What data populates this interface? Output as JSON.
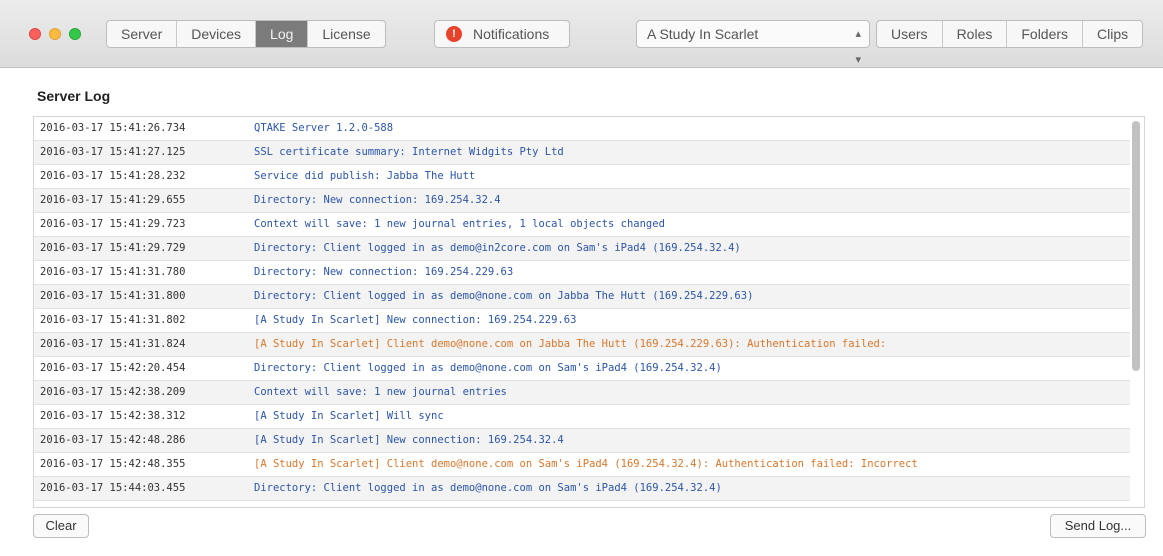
{
  "tabs": [
    {
      "label": "Server"
    },
    {
      "label": "Devices"
    },
    {
      "label": "Log",
      "active": true
    },
    {
      "label": "License"
    }
  ],
  "notifications": {
    "label": "Notifications",
    "count": "!"
  },
  "project": {
    "selected": "A Study In Scarlet"
  },
  "right_tabs": [
    {
      "label": "Users"
    },
    {
      "label": "Roles"
    },
    {
      "label": "Folders"
    },
    {
      "label": "Clips"
    }
  ],
  "page": {
    "title": "Server Log"
  },
  "colors": {
    "info": "#2b55a8",
    "warning": "#d9772b"
  },
  "log": [
    {
      "time": "2016-03-17 15:41:26.734",
      "message": "QTAKE Server 1.2.0-588",
      "level": "info"
    },
    {
      "time": "2016-03-17 15:41:27.125",
      "message": "SSL certificate summary: Internet Widgits Pty Ltd",
      "level": "info"
    },
    {
      "time": "2016-03-17 15:41:28.232",
      "message": "Service did publish: Jabba The Hutt",
      "level": "info"
    },
    {
      "time": "2016-03-17 15:41:29.655",
      "message": "Directory: New connection: 169.254.32.4",
      "level": "info"
    },
    {
      "time": "2016-03-17 15:41:29.723",
      "message": "Context will save: 1 new journal entries, 1 local objects changed",
      "level": "info"
    },
    {
      "time": "2016-03-17 15:41:29.729",
      "message": "Directory: Client logged in as demo@in2core.com on Sam's iPad4 (169.254.32.4)",
      "level": "info"
    },
    {
      "time": "2016-03-17 15:41:31.780",
      "message": "Directory: New connection: 169.254.229.63",
      "level": "info"
    },
    {
      "time": "2016-03-17 15:41:31.800",
      "message": "Directory: Client logged in as demo@none.com on Jabba The Hutt (169.254.229.63)",
      "level": "info"
    },
    {
      "time": "2016-03-17 15:41:31.802",
      "message": "[A Study In Scarlet] New connection: 169.254.229.63",
      "level": "info"
    },
    {
      "time": "2016-03-17 15:41:31.824",
      "message": "[A Study In Scarlet] Client demo@none.com on Jabba The Hutt (169.254.229.63): Authentication failed:",
      "level": "warning"
    },
    {
      "time": "2016-03-17 15:42:20.454",
      "message": "Directory: Client logged in as demo@none.com on Sam's iPad4 (169.254.32.4)",
      "level": "info"
    },
    {
      "time": "2016-03-17 15:42:38.209",
      "message": "Context will save: 1 new journal entries",
      "level": "info"
    },
    {
      "time": "2016-03-17 15:42:38.312",
      "message": "[A Study In Scarlet] Will sync",
      "level": "info"
    },
    {
      "time": "2016-03-17 15:42:48.286",
      "message": "[A Study In Scarlet] New connection: 169.254.32.4",
      "level": "info"
    },
    {
      "time": "2016-03-17 15:42:48.355",
      "message": "[A Study In Scarlet] Client demo@none.com on Sam's iPad4 (169.254.32.4): Authentication failed: Incorrect",
      "level": "warning"
    },
    {
      "time": "2016-03-17 15:44:03.455",
      "message": "Directory: Client logged in as demo@none.com on Sam's iPad4 (169.254.32.4)",
      "level": "info"
    }
  ],
  "buttons": {
    "clear": "Clear",
    "send_log": "Send Log..."
  }
}
